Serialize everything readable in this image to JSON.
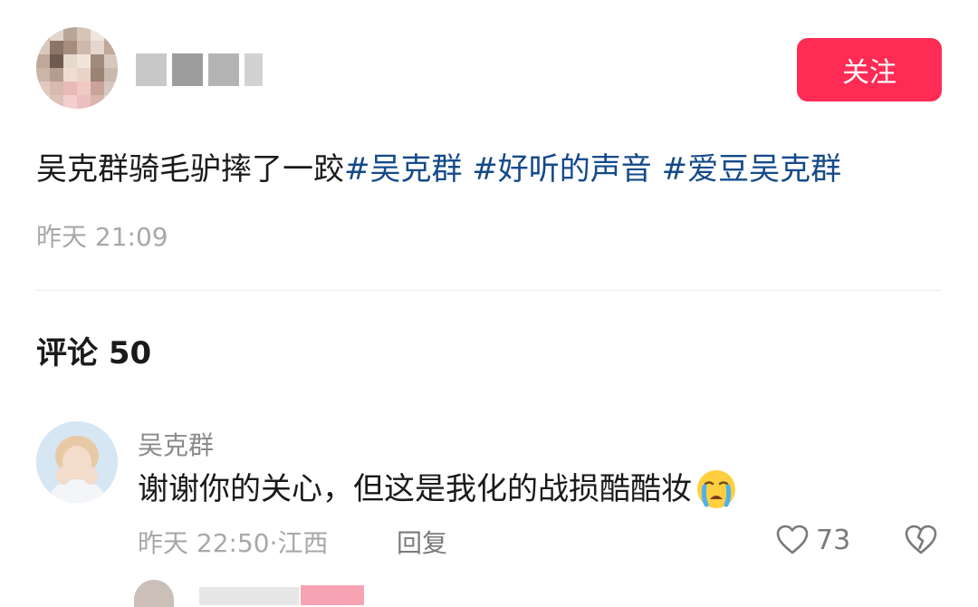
{
  "author": {
    "follow_label": "关注"
  },
  "post": {
    "text": "吴克群骑毛驴摔了一跤",
    "hashtags": [
      "#吴克群",
      "#好听的声音",
      "#爱豆吴克群"
    ],
    "time": "昨天 21:09"
  },
  "comments": {
    "title": "评论 50",
    "items": [
      {
        "username": "吴克群",
        "text": "谢谢你的关心，但这是我化的战损酷酷妆",
        "emoji": "😭",
        "meta": "昨天 22:50·江西",
        "reply_label": "回复",
        "likes": "73"
      }
    ]
  },
  "colors": {
    "accent": "#fe2c55",
    "hashtag": "#144a8a",
    "muted": "#a8a8a8"
  },
  "icons": [
    "heart-outline-icon",
    "broken-heart-icon"
  ]
}
